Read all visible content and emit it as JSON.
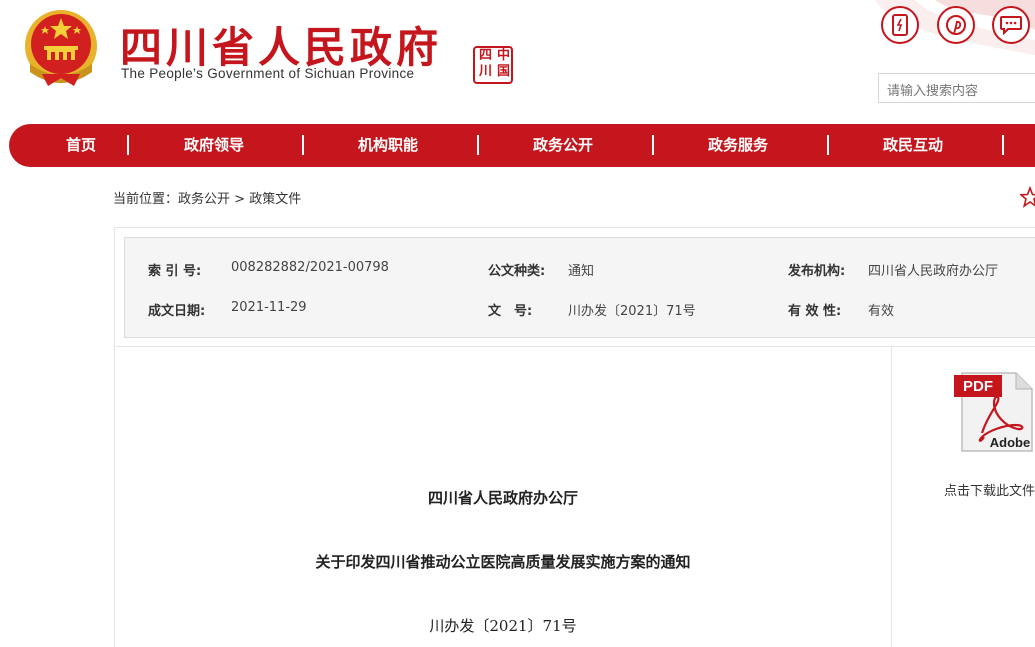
{
  "header": {
    "title": "四川省人民政府",
    "subtitle": "The People’s Government of Sichuan Province",
    "seal_chars": [
      "中",
      "国",
      "四",
      "川"
    ],
    "icons": [
      "mobile-icon",
      "pinterest-icon",
      "message-icon"
    ],
    "search_placeholder": "请输入搜索内容"
  },
  "nav": {
    "items": [
      "首页",
      "政府领导",
      "机构职能",
      "政务公开",
      "政务服务",
      "政民互动"
    ],
    "separator": "|"
  },
  "breadcrumb": {
    "prefix": "当前位置：",
    "items": [
      "政务公开",
      "政策文件"
    ],
    "separator": ">"
  },
  "meta": {
    "index_label": "索 引 号:",
    "index_value": "008282882/2021-00798",
    "type_label": "公文种类:",
    "type_value": "通知",
    "publisher_label": "发布机构:",
    "publisher_value": "四川省人民政府办公厅",
    "date_label": "成文日期:",
    "date_value": "2021-11-29",
    "docno_label": "文　号:",
    "docno_value": "川办发〔2021〕71号",
    "validity_label": "有 效 性:",
    "validity_value": "有效"
  },
  "document": {
    "issuer": "四川省人民政府办公厅",
    "title": "关于印发四川省推动公立医院高质量发展实施方案的通知",
    "number": "川办发〔2021〕71号"
  },
  "download": {
    "pdf_text": "PDF",
    "adobe_text": "Adobe",
    "label": "点击下载此文件"
  },
  "colors": {
    "brand_red": "#c4161c",
    "meta_bg": "#f5f5f5"
  }
}
